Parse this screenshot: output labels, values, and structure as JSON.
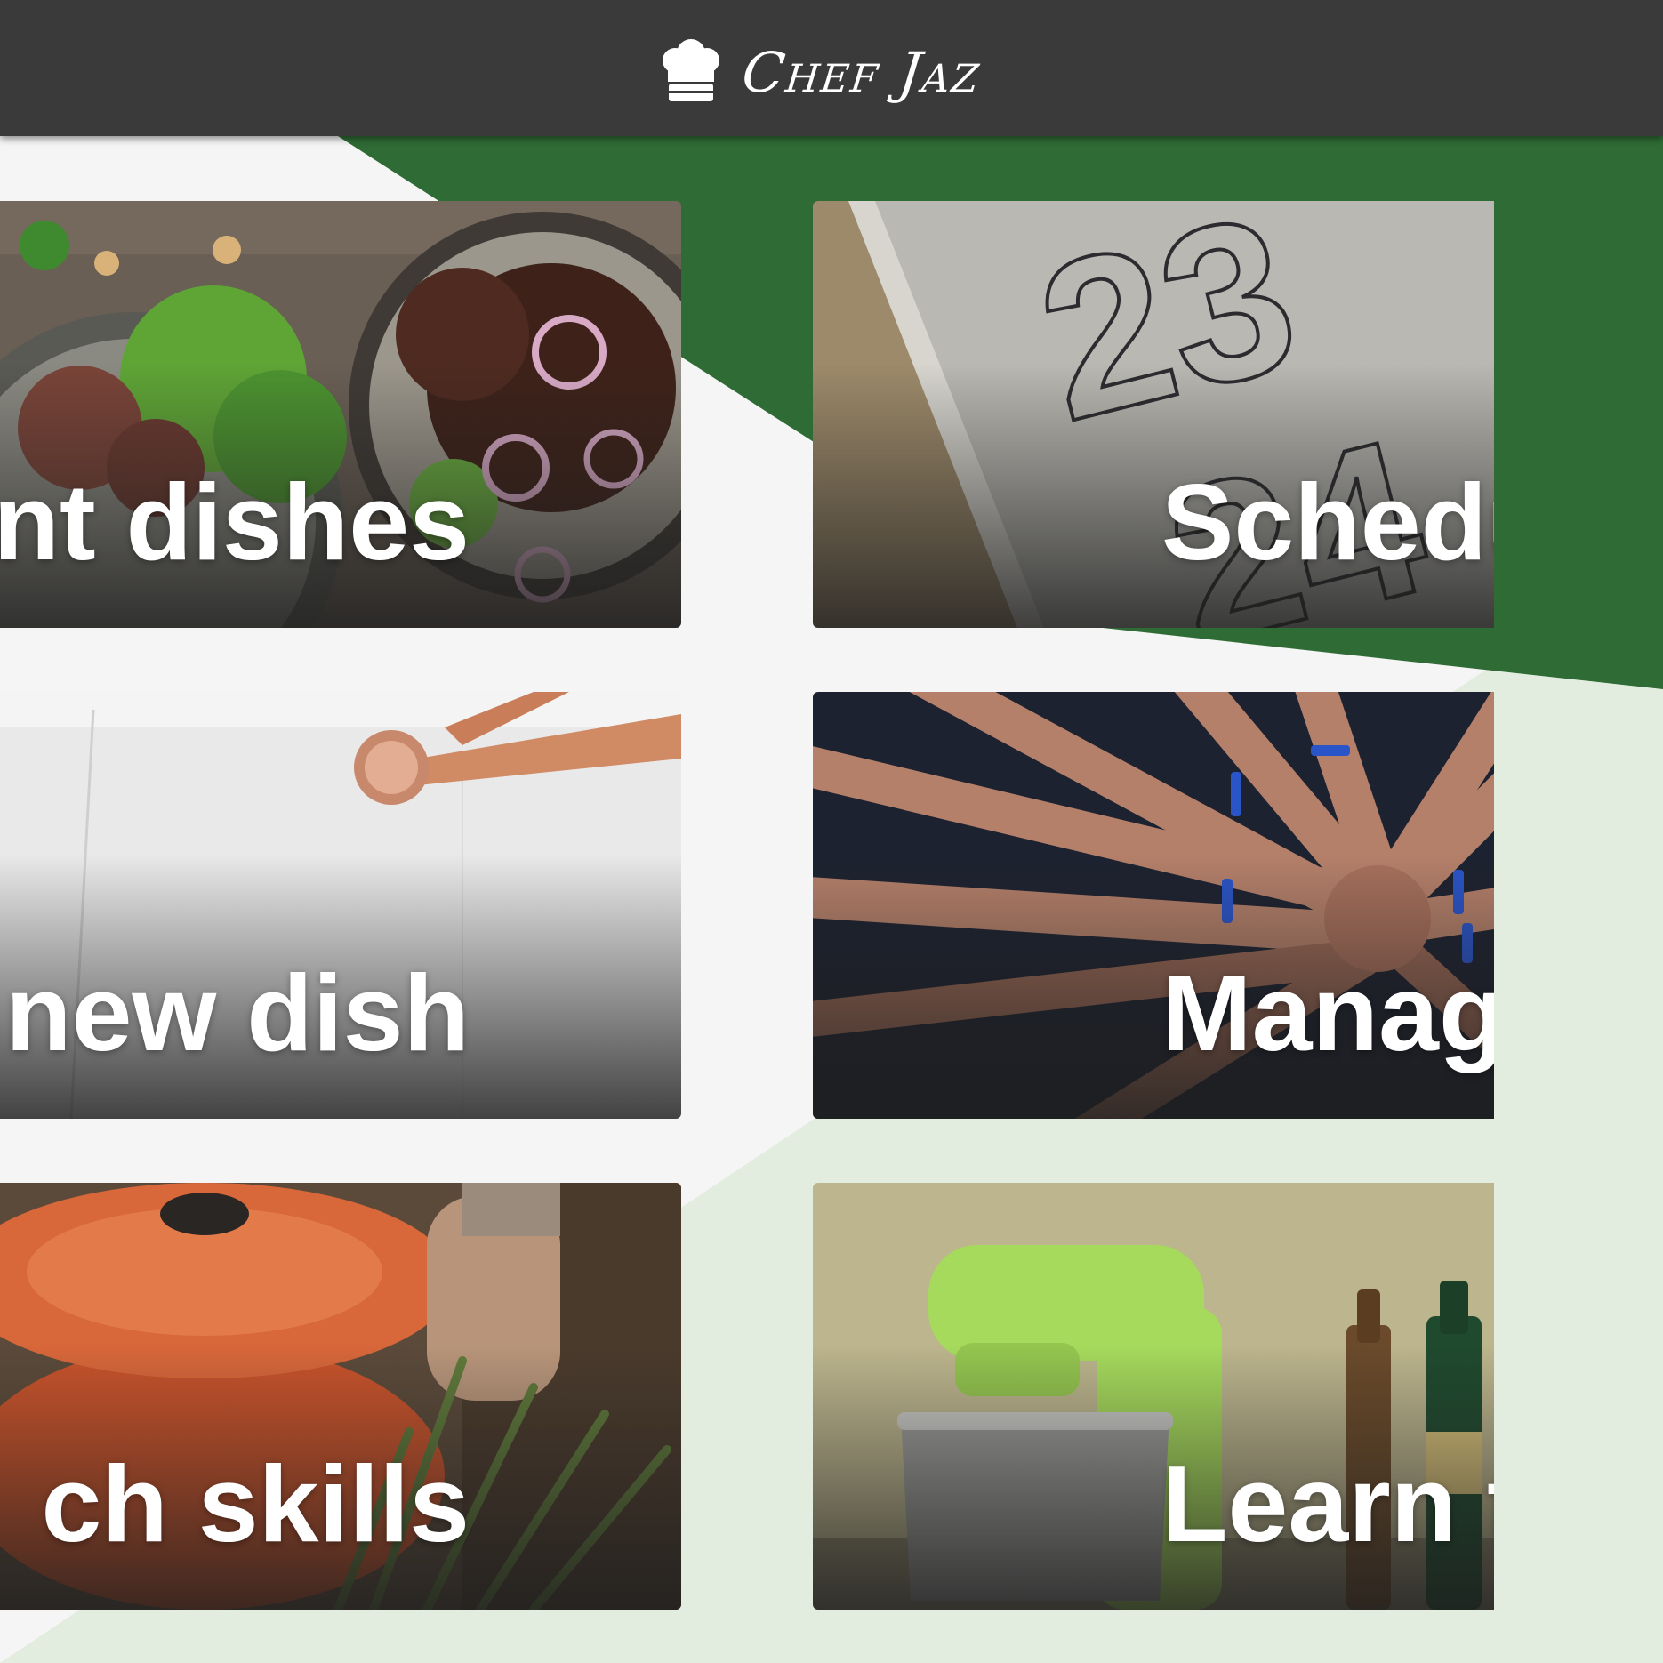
{
  "header": {
    "brand_name": "Chef Jaz",
    "logo_icon": "chef-hat-icon",
    "background_color": "#3a3a3a"
  },
  "theme": {
    "page_background": "#f5f5f5",
    "accent_dark_green": "#2f6b34",
    "accent_light_green": "#e2ede0",
    "label_color": "#ffffff"
  },
  "tiles": [
    {
      "label": "ent dishes",
      "image": "plated-beef-salad-photo"
    },
    {
      "label": "Schedule",
      "image": "calendar-page-photo"
    },
    {
      "label": "a new dish",
      "image": "copper-measuring-spoons-photo"
    },
    {
      "label": "Manage staf",
      "image": "stacked-hands-team-photo"
    },
    {
      "label": "ch skills",
      "image": "orange-dutch-oven-photo"
    },
    {
      "label": "Learn tools",
      "image": "green-stand-mixer-photo"
    }
  ]
}
